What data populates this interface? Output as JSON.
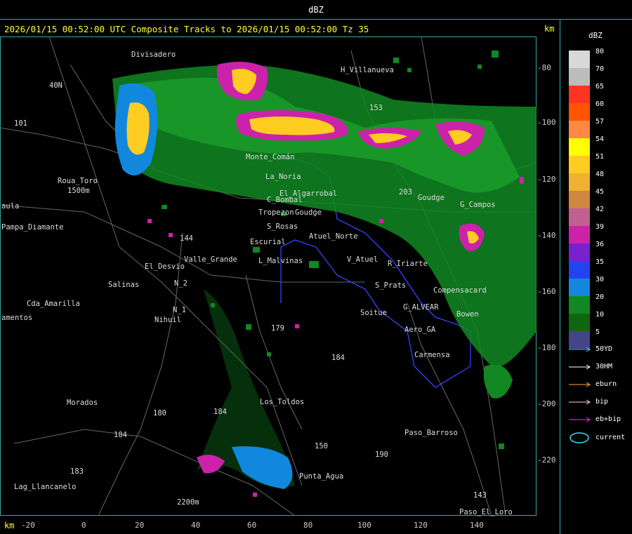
{
  "window": {
    "title": "dBZ"
  },
  "caption": "2026/01/15 00:52:00 UTC Composite Tracks to 2026/01/15 00:52:00 Tz 35",
  "units": {
    "km": "km"
  },
  "y_axis": [
    "-80",
    "-100",
    "-120",
    "-140",
    "-160",
    "-180",
    "-200",
    "-220"
  ],
  "x_axis": [
    "-20",
    "0",
    "20",
    "40",
    "60",
    "80",
    "100",
    "120",
    "140"
  ],
  "colors": {
    "border": "#33aaaa",
    "axis_text": "#ffff33",
    "roads": "#777777",
    "province_border": "#3344ff"
  },
  "places": [
    "Divisadero",
    "H_Villanueva",
    "40N",
    "101",
    "Roua_Toro",
    "1500m",
    "aula",
    "Pampa_Diamante",
    "Monte_Comán",
    "La_Noria",
    "El_Algarrobal",
    "C_Bombal",
    "Tropezon",
    "Goudge",
    "Goudge",
    "G_Campos",
    "S_Rosas",
    "Atuel_Norte",
    "Escurial",
    "Valle_Grande",
    "L_Malvinas",
    "V_Atuel",
    "R_Iriarte",
    "El_Desvio",
    "Salinas",
    "N_2",
    "N_1",
    "Nihuil",
    "Cda_Amarilla",
    "amentos",
    "S_Prats",
    "G_ALVEAR",
    "Soitue",
    "Aero_GA",
    "Carmensa",
    "Los_Toldos",
    "Morados",
    "180",
    "184",
    "184",
    "183",
    "Lag_Llancanelo",
    "Paso_Barroso",
    "Punta_Agua",
    "2200m",
    "Paso_El_Loro",
    "143",
    "190",
    "153",
    "203",
    "184",
    "179",
    "144",
    "150",
    "Bowen",
    "Compensacard"
  ],
  "legend": {
    "title": "dBZ",
    "scale": [
      {
        "value": "80",
        "color": "#d8d8d8"
      },
      {
        "value": "70",
        "color": "#bcbcbc"
      },
      {
        "value": "65",
        "color": "#ff3322"
      },
      {
        "value": "60",
        "color": "#ff5500"
      },
      {
        "value": "57",
        "color": "#ff8844"
      },
      {
        "value": "54",
        "color": "#ffff00"
      },
      {
        "value": "51",
        "color": "#ffcc22"
      },
      {
        "value": "48",
        "color": "#f0b030"
      },
      {
        "value": "45",
        "color": "#d08840"
      },
      {
        "value": "42",
        "color": "#c06090"
      },
      {
        "value": "39",
        "color": "#cc22aa"
      },
      {
        "value": "36",
        "color": "#7722cc"
      },
      {
        "value": "35",
        "color": "#2244ee"
      },
      {
        "value": "30",
        "color": "#1188dd"
      },
      {
        "value": "20",
        "color": "#118822"
      },
      {
        "value": "10",
        "color": "#116611"
      },
      {
        "value": "5",
        "color": "#444488"
      }
    ],
    "tracks": [
      {
        "label": "50YD",
        "color": "#33ddee"
      },
      {
        "label": "30HM",
        "color": "#ffffff"
      },
      {
        "label": "eburn",
        "color": "#ffaa33"
      },
      {
        "label": "bip",
        "color": "#ffccdd"
      },
      {
        "label": "eb+bip",
        "color": "#ff22ff"
      },
      {
        "label": "current",
        "color": "#33ddee"
      }
    ]
  }
}
